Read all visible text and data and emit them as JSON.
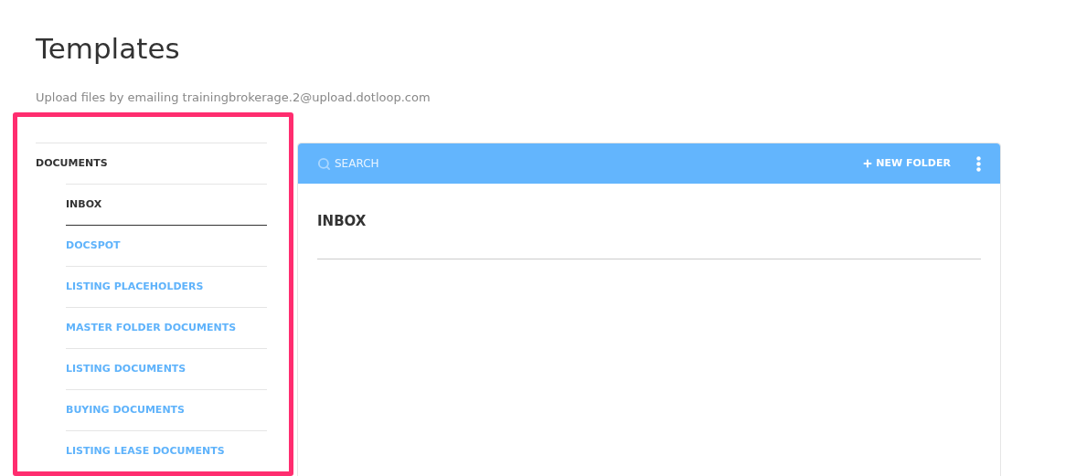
{
  "page": {
    "title": "Templates",
    "subtitle": "Upload files by emailing trainingbrokerage.2@upload.dotloop.com"
  },
  "sidebar": {
    "section": "DOCUMENTS",
    "items": [
      {
        "label": "INBOX",
        "selected": true
      },
      {
        "label": "DOCSPOT",
        "selected": false
      },
      {
        "label": "LISTING PLACEHOLDERS",
        "selected": false
      },
      {
        "label": "MASTER FOLDER DOCUMENTS",
        "selected": false
      },
      {
        "label": "LISTING DOCUMENTS",
        "selected": false
      },
      {
        "label": "BUYING DOCUMENTS",
        "selected": false
      },
      {
        "label": "LISTING LEASE DOCUMENTS",
        "selected": false
      }
    ]
  },
  "toolbar": {
    "search": {
      "placeholder": "SEARCH"
    },
    "new_folder": "NEW FOLDER"
  },
  "folder": {
    "title": "INBOX"
  }
}
